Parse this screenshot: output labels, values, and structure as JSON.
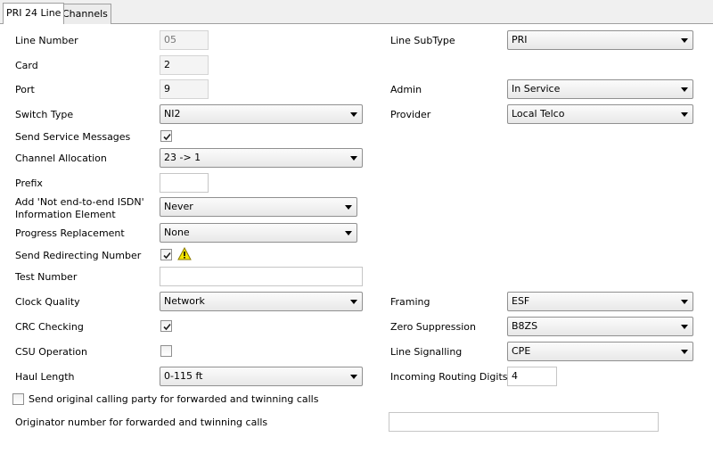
{
  "tabs": [
    {
      "label": "PRI 24 Line",
      "active": true
    },
    {
      "label": "Channels",
      "active": false
    }
  ],
  "fields": {
    "line_number": {
      "label": "Line Number",
      "value": "05"
    },
    "card": {
      "label": "Card",
      "value": "2"
    },
    "port": {
      "label": "Port",
      "value": "9"
    },
    "switch_type": {
      "label": "Switch Type",
      "value": "NI2"
    },
    "send_service_messages": {
      "label": "Send Service Messages",
      "checked": true
    },
    "channel_allocation": {
      "label": "Channel Allocation",
      "value": "23 -> 1"
    },
    "prefix": {
      "label": "Prefix",
      "value": ""
    },
    "not_end_to_end": {
      "label_line1": "Add 'Not end-to-end ISDN'",
      "label_line2": "Information Element",
      "value": "Never"
    },
    "progress_replacement": {
      "label": "Progress Replacement",
      "value": "None"
    },
    "send_redirecting_number": {
      "label": "Send Redirecting Number",
      "checked": true,
      "warning_icon": "warning-triangle-icon"
    },
    "test_number": {
      "label": "Test Number",
      "value": ""
    },
    "clock_quality": {
      "label": "Clock Quality",
      "value": "Network"
    },
    "crc_checking": {
      "label": "CRC Checking",
      "checked": true
    },
    "csu_operation": {
      "label": "CSU Operation",
      "checked": false
    },
    "haul_length": {
      "label": "Haul Length",
      "value": "0-115 ft"
    },
    "line_subtype": {
      "label": "Line SubType",
      "value": "PRI"
    },
    "admin": {
      "label": "Admin",
      "value": "In Service"
    },
    "provider": {
      "label": "Provider",
      "value": "Local Telco"
    },
    "framing": {
      "label": "Framing",
      "value": "ESF"
    },
    "zero_suppression": {
      "label": "Zero Suppression",
      "value": "B8ZS"
    },
    "line_signalling": {
      "label": "Line Signalling",
      "value": "CPE"
    },
    "incoming_routing_digits": {
      "label": "Incoming Routing Digits",
      "value": "4"
    },
    "send_original_calling_party": {
      "label": "Send original calling party for forwarded and twinning calls",
      "checked": false
    },
    "originator_number": {
      "label": "Originator number for forwarded and twinning calls",
      "value": ""
    }
  },
  "colors": {
    "warning": "#f5e600",
    "tab_border": "#a0a0a0"
  }
}
